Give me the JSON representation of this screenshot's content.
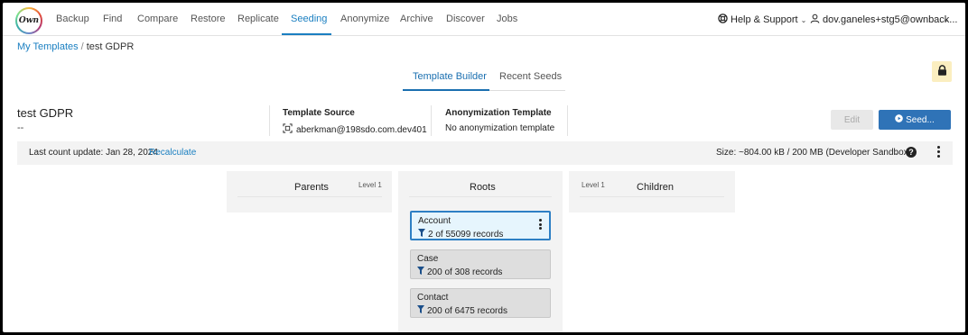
{
  "nav": {
    "logo_text": "Own",
    "items": [
      {
        "label": "Backup"
      },
      {
        "label": "Find"
      },
      {
        "label": "Compare"
      },
      {
        "label": "Restore"
      },
      {
        "label": "Replicate"
      },
      {
        "label": "Seeding",
        "active": true
      },
      {
        "label": "Anonymize"
      },
      {
        "label": "Archive"
      },
      {
        "label": "Discover"
      },
      {
        "label": "Jobs"
      }
    ],
    "help_label": "Help & Support",
    "user_label": "dov.ganeles+stg5@ownback..."
  },
  "breadcrumb": {
    "parent": "My Templates",
    "separator": "/",
    "current": "test GDPR"
  },
  "tabs": {
    "builder": "Template Builder",
    "recent": "Recent Seeds"
  },
  "template": {
    "name": "test GDPR",
    "description": "--",
    "source_label": "Template Source",
    "source_value": "aberkman@198sdo.com.dev401",
    "anon_label": "Anonymization Template",
    "anon_value": "No anonymization template"
  },
  "actions": {
    "edit_label": "Edit",
    "seed_label": "Seed..."
  },
  "countbar": {
    "last_count": "Last count update: Jan 28, 2024",
    "recalc_label": "Recalculate",
    "size_text": "Size:  ~804.00 kB / 200 MB (Developer Sandbox)",
    "help_glyph": "?"
  },
  "columns": {
    "parents_title": "Parents",
    "parents_level": "Level 1",
    "roots_title": "Roots",
    "children_title": "Children",
    "children_level": "Level 1"
  },
  "roots": [
    {
      "name": "Account",
      "count": "2 of 55099 records",
      "selected": true
    },
    {
      "name": "Case",
      "count": "200 of 308 records",
      "selected": false
    },
    {
      "name": "Contact",
      "count": "200 of 6475 records",
      "selected": false
    }
  ],
  "colors": {
    "accent": "#1a7fc1",
    "primary_button": "#2f73b7",
    "lock_background": "#fbeec0",
    "selected_card_bg": "#e6f5fd"
  }
}
